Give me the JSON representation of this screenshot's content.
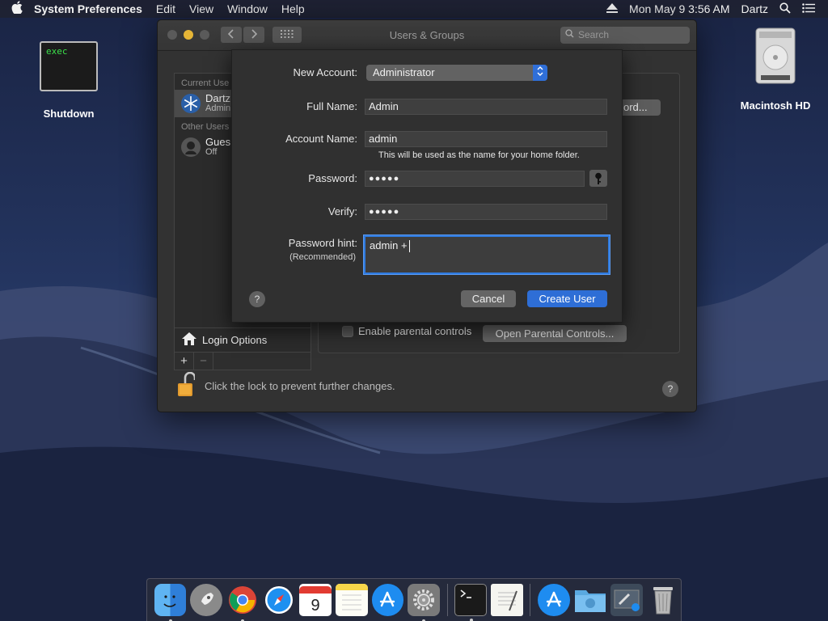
{
  "menubar": {
    "app": "System Preferences",
    "items": [
      "Edit",
      "View",
      "Window",
      "Help"
    ],
    "datetime": "Mon May 9  3:56 AM",
    "user": "Dartz"
  },
  "desktop": {
    "exec_text": "exec",
    "exec_label": "Shutdown",
    "hd_label": "Macintosh HD"
  },
  "window": {
    "title": "Users & Groups",
    "search_placeholder": "Search",
    "sidebar": {
      "current_header": "Current Use",
      "current_user_name": "Dartz",
      "current_user_role": "Admin",
      "other_header": "Other Users",
      "guest_name": "Gues",
      "guest_status": "Off",
      "login_options": "Login Options"
    },
    "password_button": "ord...",
    "parental_checkbox_label": "Enable parental controls",
    "parental_button": "Open Parental Controls...",
    "lock_text": "Click the lock to prevent further changes.",
    "help": "?"
  },
  "sheet": {
    "new_account_label": "New Account:",
    "new_account_value": "Administrator",
    "full_name_label": "Full Name:",
    "full_name_value": "Admin",
    "account_name_label": "Account Name:",
    "account_name_value": "admin",
    "account_name_note": "This will be used as the name for your home folder.",
    "password_label": "Password:",
    "password_value": "●●●●●",
    "verify_label": "Verify:",
    "verify_value": "●●●●●",
    "hint_label": "Password hint:",
    "hint_sublabel": "(Recommended)",
    "hint_value": "admin +",
    "help": "?",
    "cancel": "Cancel",
    "create": "Create User"
  },
  "colors": {
    "accent": "#2e6ed6",
    "window_bg": "#323232"
  }
}
